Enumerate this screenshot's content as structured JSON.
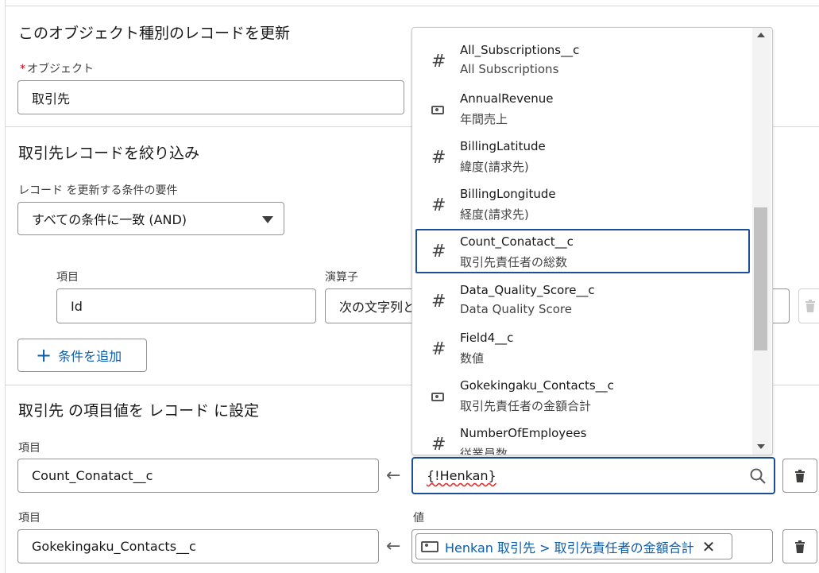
{
  "object_section": {
    "title": "このオブジェクト種別のレコードを更新",
    "object_label": "オブジェクト",
    "object_value": "取引先"
  },
  "filter_section": {
    "title": "取引先レコードを絞り込み",
    "condition_label": "レコード を更新する条件の要件",
    "condition_value": "すべての条件に一致 (AND)",
    "field_header": "項目",
    "operator_header": "演算子",
    "field_value": "Id",
    "operator_value": "次の文字列と",
    "add_condition_label": "条件を追加"
  },
  "set_section": {
    "title": "取引先 の項目値を レコード に設定",
    "rows": [
      {
        "field_label": "項目",
        "field_value": "Count_Conatact__c",
        "value_label": "",
        "value_input": "{!Henkan}"
      },
      {
        "field_label": "項目",
        "field_value": "Gokekingaku_Contacts__c",
        "value_label": "値",
        "value_pill": "Henkan 取引先 > 取引先責任者の金額合計"
      }
    ]
  },
  "dropdown": {
    "options": [
      {
        "api": "All_Subscriptions__c",
        "label": "All Subscriptions",
        "icon": "number-icon"
      },
      {
        "api": "AnnualRevenue",
        "label": "年間売上",
        "icon": "currency-icon"
      },
      {
        "api": "BillingLatitude",
        "label": "緯度(請求先)",
        "icon": "number-icon"
      },
      {
        "api": "BillingLongitude",
        "label": "経度(請求先)",
        "icon": "number-icon"
      },
      {
        "api": "Count_Conatact__c",
        "label": "取引先責任者の総数",
        "icon": "number-icon",
        "selected": true
      },
      {
        "api": "Data_Quality_Score__c",
        "label": "Data Quality Score",
        "icon": "number-icon"
      },
      {
        "api": "Field4__c",
        "label": "数値",
        "icon": "number-icon"
      },
      {
        "api": "Gokekingaku_Contacts__c",
        "label": "取引先責任者の金額合計",
        "icon": "currency-icon"
      },
      {
        "api": "NumberOfEmployees",
        "label": "従業員数",
        "icon": "number-icon"
      }
    ]
  },
  "icons": {
    "hash": "#",
    "arrow": "←",
    "plus": "+",
    "close": "✕"
  },
  "colors": {
    "accent": "#0b5cab",
    "selected_border": "#1b4f9c",
    "required": "#ba0517"
  }
}
